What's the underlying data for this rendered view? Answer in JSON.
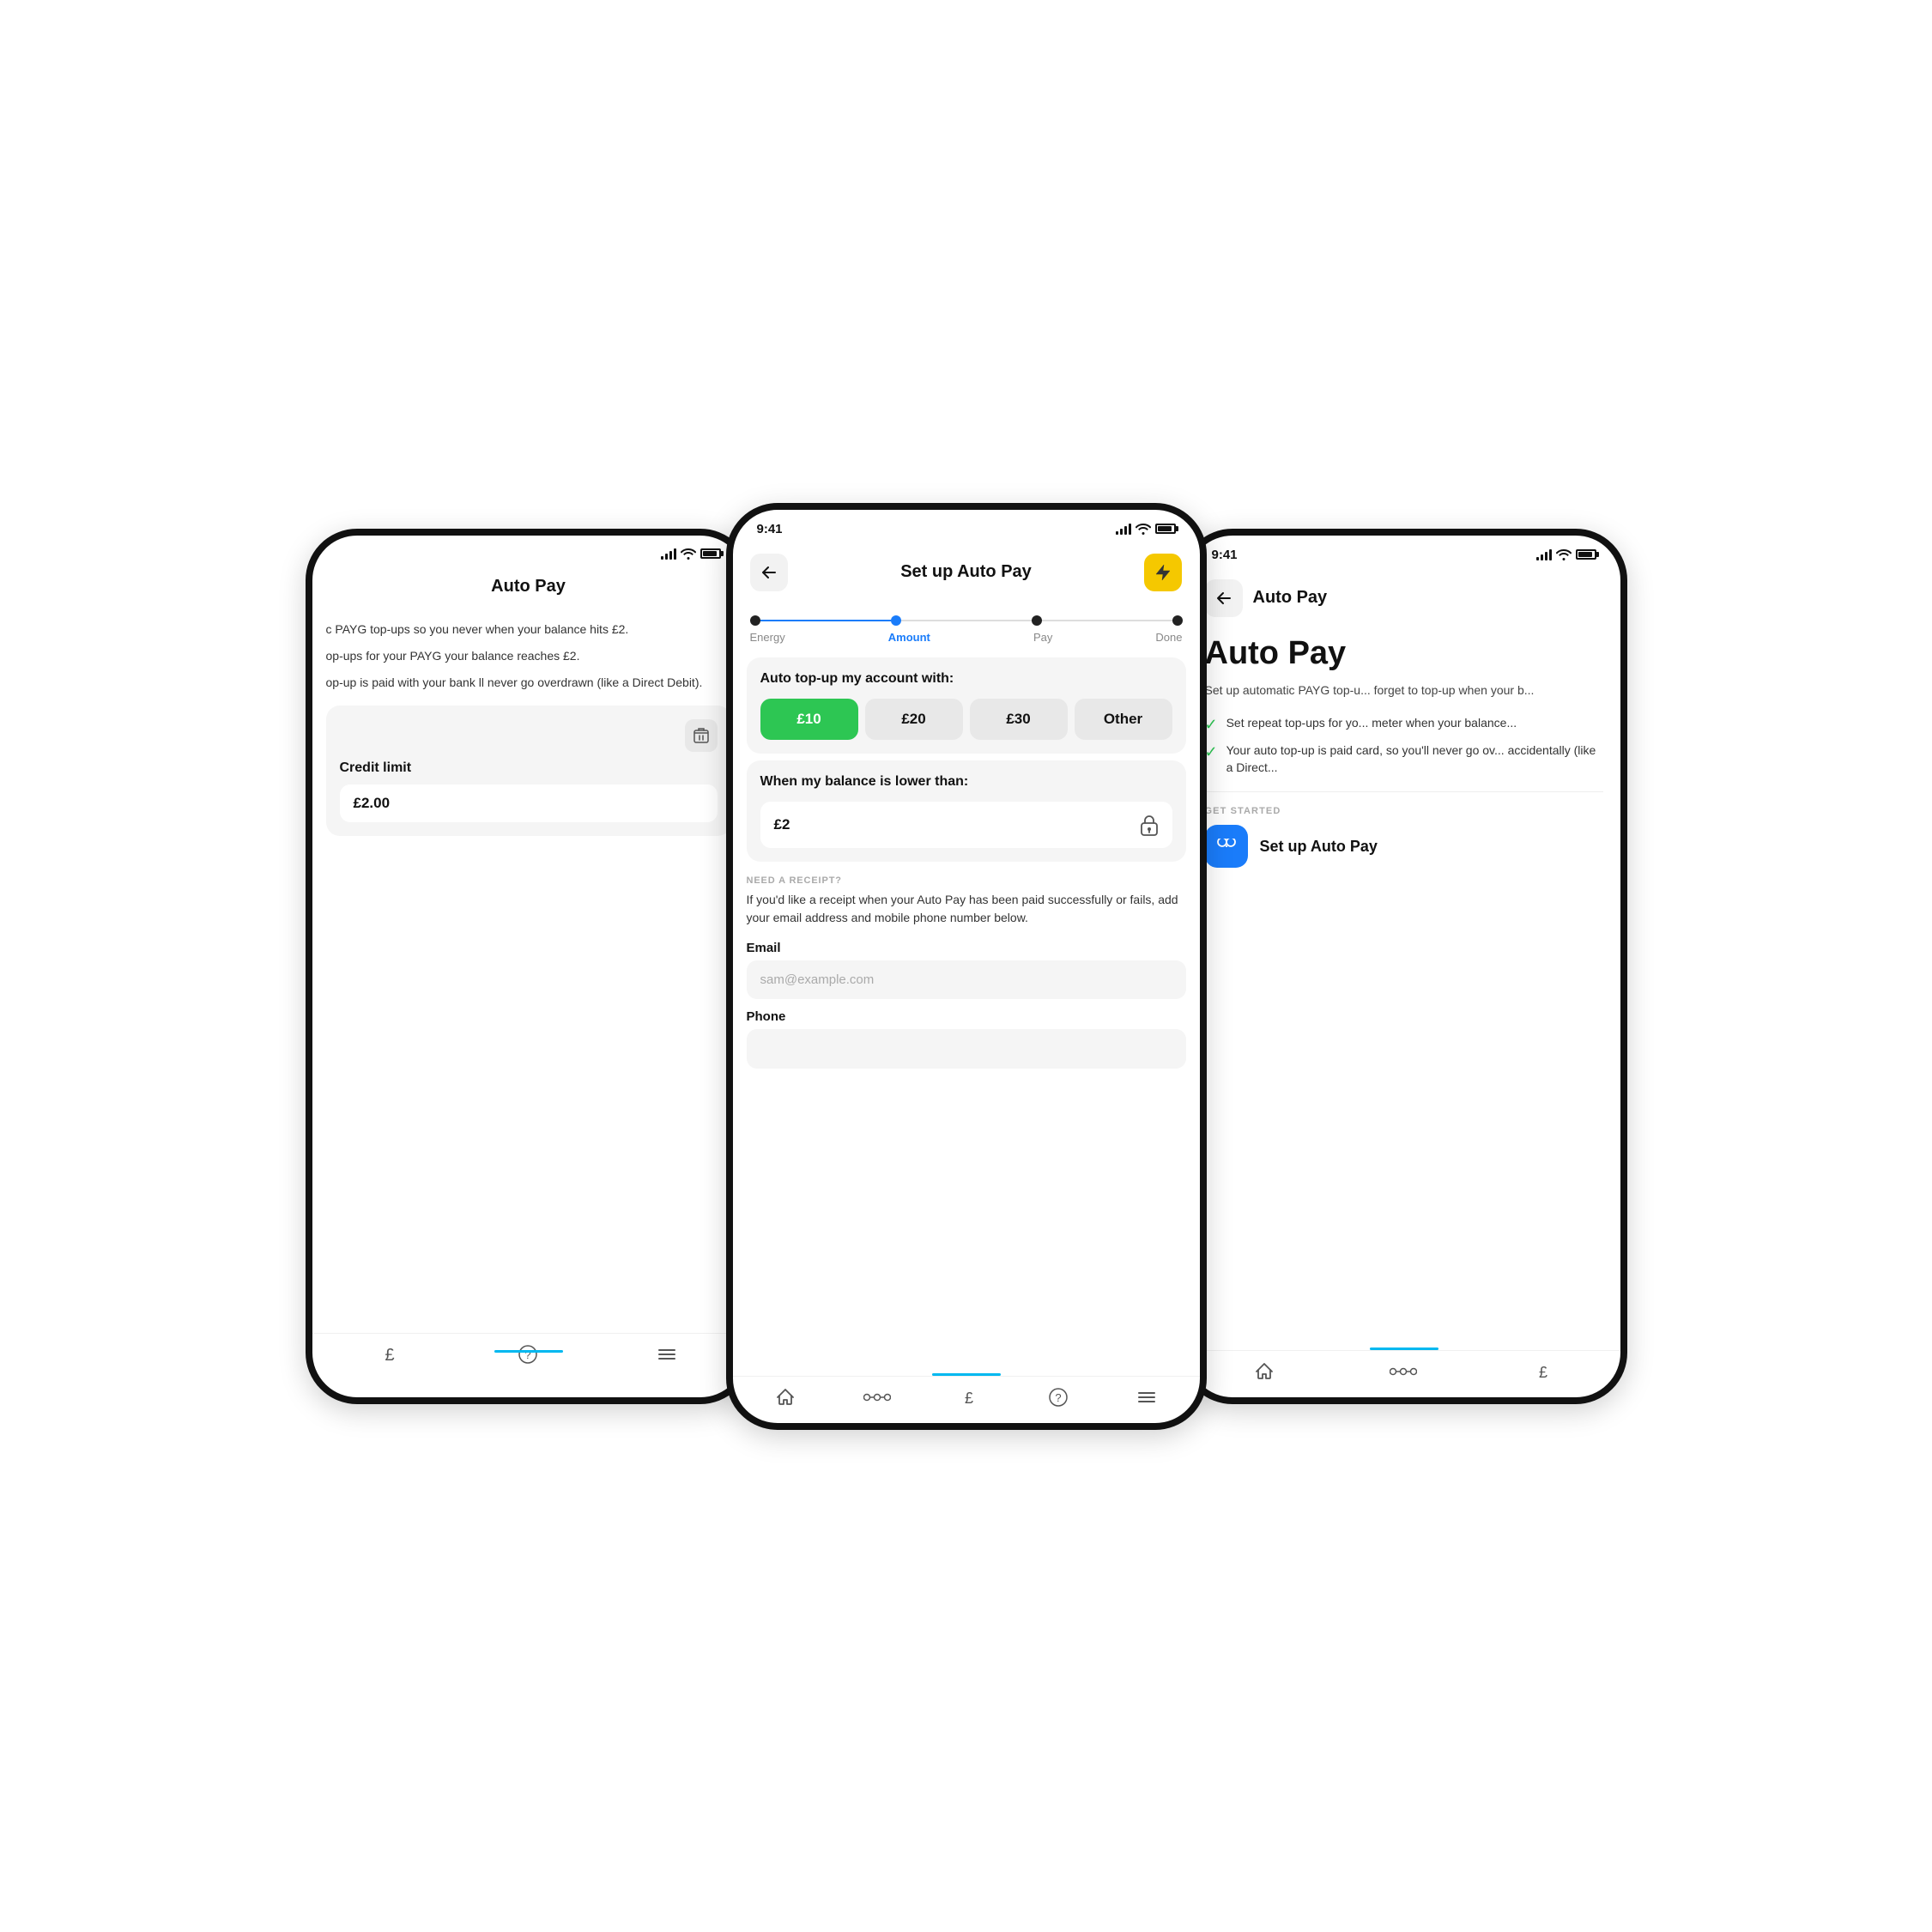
{
  "scene": {
    "background": "#ffffff"
  },
  "left_phone": {
    "status": {
      "time": "",
      "has_signal": true,
      "has_wifi": true,
      "has_battery": true
    },
    "header": {
      "title": "Auto Pay"
    },
    "body_text_1": "c PAYG top-ups so you never when your balance hits £2.",
    "body_text_2": "op-ups for your PAYG your balance reaches £2.",
    "body_text_3": "op-up is paid with your bank ll never go overdrawn (like a Direct Debit).",
    "credit_card": {
      "title": "Credit limit",
      "value": "£2.00"
    },
    "nav_items": [
      "£",
      "?",
      "≡"
    ]
  },
  "center_phone": {
    "status": {
      "time": "9:41"
    },
    "header": {
      "title": "Set up Auto Pay",
      "back_label": "←",
      "action_icon": "⚡"
    },
    "steps": [
      {
        "label": "Energy",
        "active": false
      },
      {
        "label": "Amount",
        "active": true
      },
      {
        "label": "Pay",
        "active": false
      },
      {
        "label": "Done",
        "active": false
      }
    ],
    "top_up_card": {
      "title": "Auto top-up my account with:",
      "options": [
        {
          "label": "£10",
          "selected": true
        },
        {
          "label": "£20",
          "selected": false
        },
        {
          "label": "£30",
          "selected": false
        },
        {
          "label": "Other",
          "selected": false
        }
      ]
    },
    "balance_card": {
      "title": "When my balance is lower than:",
      "value": "£2"
    },
    "receipt_section": {
      "label": "NEED A RECEIPT?",
      "text": "If you'd like a receipt when your Auto Pay has been paid successfully or fails, add your email address and mobile phone number below."
    },
    "email_field": {
      "label": "Email",
      "placeholder": "sam@example.com"
    },
    "phone_field": {
      "label": "Phone",
      "placeholder": ""
    },
    "nav_items": [
      "🏠",
      "⬤—⬤",
      "£",
      "?",
      "≡"
    ]
  },
  "right_phone": {
    "status": {
      "time": "9:41"
    },
    "header": {
      "title": "Auto Pay",
      "back_label": "←"
    },
    "page_title": "Auto Pay",
    "body_text": "Set up automatic PAYG top-u... forget to top-up when your b...",
    "check_items": [
      "Set repeat top-ups for yo... meter when your balance...",
      "Your auto top-up is paid card, so you'll never go ov... accidentally (like a Direct..."
    ],
    "get_started_label": "GET STARTED",
    "setup_button": {
      "label": "Set up Auto Pay",
      "icon": "∞"
    },
    "nav_items": [
      "🏠",
      "⬤—⬤",
      "£"
    ]
  },
  "colors": {
    "green": "#2dc653",
    "blue": "#1a7cfa",
    "yellow": "#f5c800",
    "cyan": "#00b8f0",
    "light_gray": "#f5f5f5",
    "mid_gray": "#e8e8e8",
    "dark": "#111111",
    "text_muted": "#888888"
  }
}
